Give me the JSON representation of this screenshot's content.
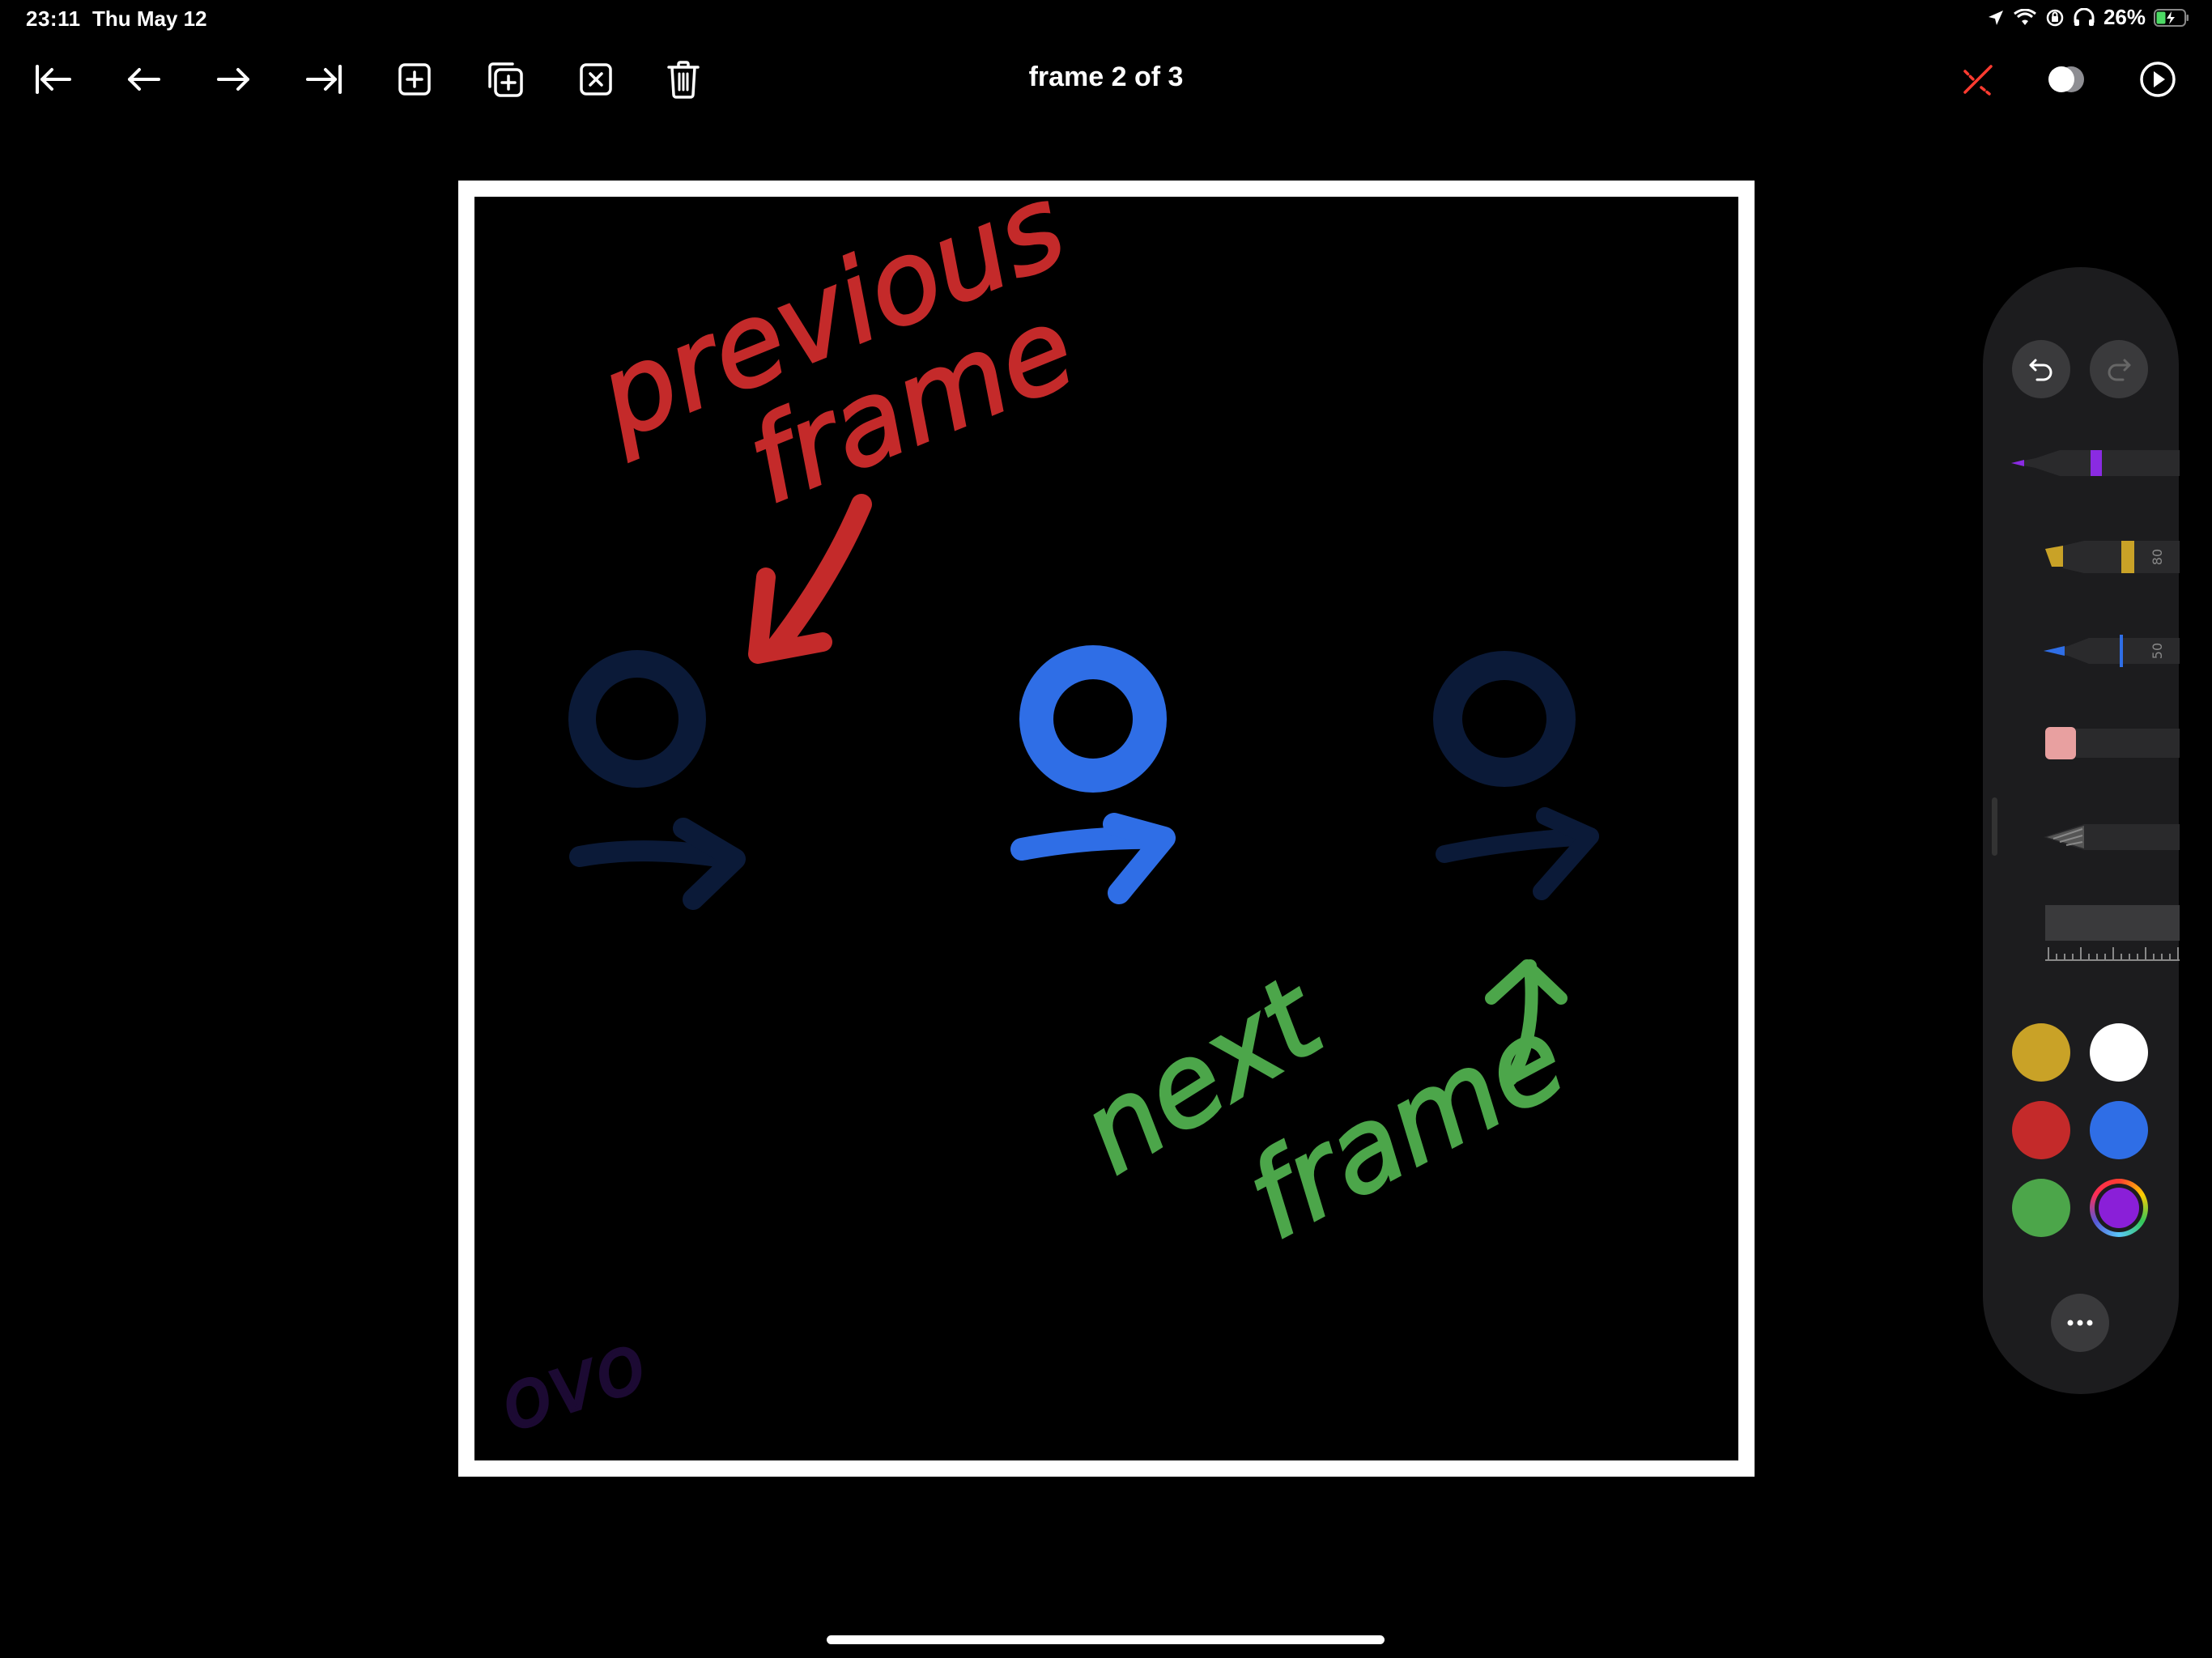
{
  "status_bar": {
    "time": "23:11",
    "date": "Thu May 12",
    "battery": "26%",
    "icons": [
      "location-icon",
      "wifi-icon",
      "orientation-lock-icon",
      "headphones-icon",
      "battery-icon"
    ]
  },
  "toolbar": {
    "frame_label": "frame 2 of 3",
    "left_buttons": [
      "go-to-first-frame-icon",
      "previous-frame-icon",
      "next-frame-icon",
      "go-to-last-frame-icon",
      "add-frame-icon",
      "duplicate-frame-icon",
      "clear-frame-icon",
      "delete-frame-icon"
    ],
    "right_buttons": [
      "onion-skin-off-icon",
      "overlay-toggle-icon",
      "play-icon"
    ]
  },
  "canvas": {
    "background": "#000000",
    "border_color": "#ffffff",
    "drawings": {
      "previous_annotation": [
        "previous",
        "frame"
      ],
      "next_annotation": [
        "next",
        "frame"
      ],
      "signature": "ovo"
    },
    "colors": {
      "previous": "#c42a2a",
      "next": "#4ca64a",
      "current": "#2f6ee6",
      "ghost": "#0b1a38",
      "signature": "#1c0a33"
    }
  },
  "tool_palette": {
    "undo": "undo-icon",
    "redo": "redo-icon",
    "tools": [
      {
        "name": "pen",
        "band_color": "#8a2be2"
      },
      {
        "name": "marker",
        "band_color": "#c9a227",
        "label": "80"
      },
      {
        "name": "pencil",
        "band_color": "#2f6ee6",
        "label": "50"
      },
      {
        "name": "eraser",
        "band_color": "#e8a0a0"
      },
      {
        "name": "lasso"
      },
      {
        "name": "ruler"
      }
    ],
    "swatches": [
      "#c9a227",
      "#ffffff",
      "#c42a2a",
      "#2f6ee6",
      "#4ca64a",
      "#8a1fd8"
    ],
    "selected_swatch": "#8a1fd8",
    "more": "more-icon"
  }
}
